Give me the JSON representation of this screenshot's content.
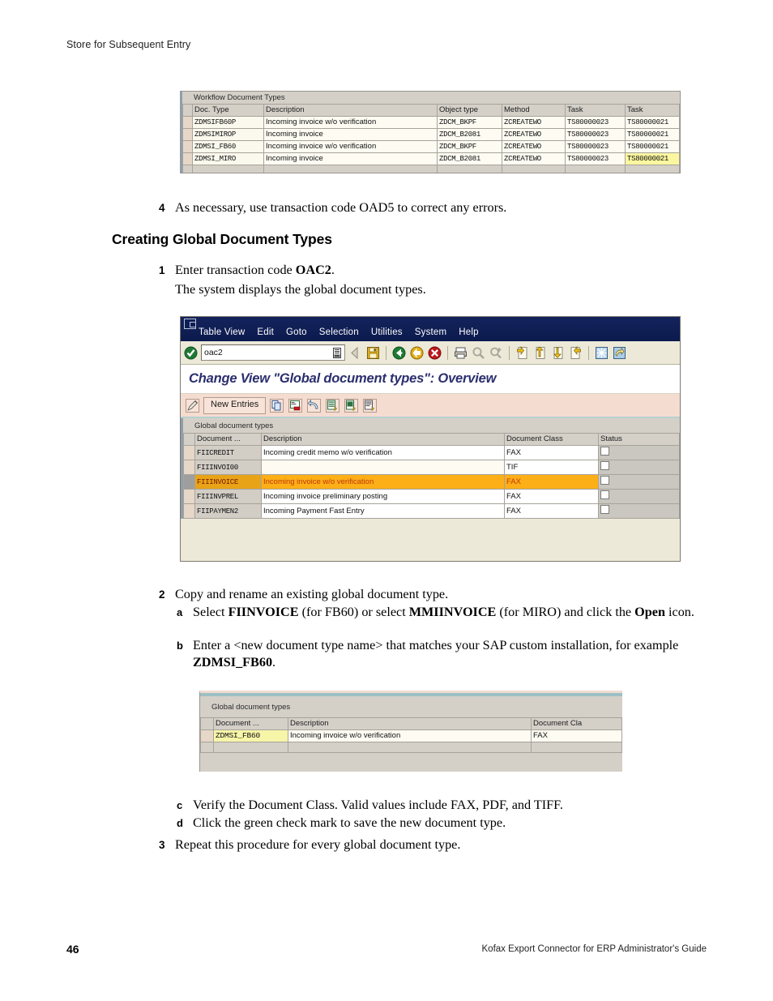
{
  "page": {
    "running_head": "Store for Subsequent Entry",
    "page_number": "46",
    "footer_title": "Kofax Export Connector for ERP Administrator's Guide"
  },
  "figure_workflow": {
    "caption": "Workflow Document Types",
    "columns": [
      "Doc. Type",
      "Description",
      "Object type",
      "Method",
      "Task",
      "Task"
    ],
    "rows": [
      {
        "doc_type": "ZDMSIFB60P",
        "description": "Incoming invoice w/o verification",
        "object_type": "ZDCM_BKPF",
        "method": "ZCREATEWO",
        "task1": "TS80000023",
        "task2": "TS80000021"
      },
      {
        "doc_type": "ZDMSIMIROP",
        "description": "Incoming invoice",
        "object_type": "ZDCM_B2081",
        "method": "ZCREATEWO",
        "task1": "TS80000023",
        "task2": "TS80000021"
      },
      {
        "doc_type": "ZDMSI_FB60",
        "description": "Incoming invoice w/o verification",
        "object_type": "ZDCM_BKPF",
        "method": "ZCREATEWO",
        "task1": "TS80000023",
        "task2": "TS80000021"
      },
      {
        "doc_type": "ZDMSI_MIRO",
        "description": "Incoming invoice",
        "object_type": "ZDCM_B2081",
        "method": "ZCREATEWO",
        "task1": "TS80000023",
        "task2": "TS80000021"
      }
    ]
  },
  "step4": {
    "number": "4",
    "text_before": "As necessary, use transaction code ",
    "code": "OAD5",
    "text_after": " to correct any errors."
  },
  "heading": "Creating Global Document Types",
  "step1": {
    "number": "1",
    "text_before": "Enter transaction code ",
    "code": "OAC2",
    "text_after": ".",
    "result": "The system displays the global document types."
  },
  "figure_oac2": {
    "menu": [
      "Table View",
      "Edit",
      "Goto",
      "Selection",
      "Utilities",
      "System",
      "Help"
    ],
    "command_field_value": "oac2",
    "title": "Change View \"Global document types\": Overview",
    "app_toolbar": {
      "new_entries_label": "New Entries"
    },
    "grid": {
      "caption": "Global document types",
      "columns": [
        "Document ...",
        "Description",
        "Document Class",
        "Status"
      ],
      "rows": [
        {
          "document": "FIICREDIT",
          "description": "Incoming credit memo w/o verification",
          "document_class": "FAX",
          "selected": false
        },
        {
          "document": "FIIINVOI00",
          "description": "",
          "document_class": "TIF",
          "selected": false
        },
        {
          "document": "FIIINVOICE",
          "description": "Incoming invoice w/o verification",
          "document_class": "FAX",
          "selected": true
        },
        {
          "document": "FIIINVPREL",
          "description": "Incoming invoice preliminary posting",
          "document_class": "FAX",
          "selected": false
        },
        {
          "document": "FIIPAYMEN2",
          "description": "Incoming Payment Fast Entry",
          "document_class": "FAX",
          "selected": false
        }
      ]
    }
  },
  "step2": {
    "number": "2",
    "text": "Copy and rename an existing global document type.",
    "substeps": [
      {
        "letter": "a",
        "parts": [
          {
            "t": "Select ",
            "b": false
          },
          {
            "t": "FIINVOICE",
            "b": true
          },
          {
            "t": " (for FB60) or select ",
            "b": false
          },
          {
            "t": "MMIINVOICE",
            "b": true
          },
          {
            "t": " (for MIRO) and click the ",
            "b": false
          },
          {
            "t": "Open",
            "b": true
          },
          {
            "t": " icon.",
            "b": false
          }
        ]
      },
      {
        "letter": "b",
        "parts": [
          {
            "t": "Enter a <new document type name> that matches your SAP custom installation, for example ",
            "b": false
          },
          {
            "t": "ZDMSI_FB60",
            "b": true
          },
          {
            "t": ".",
            "b": false
          }
        ]
      }
    ]
  },
  "figure_copy": {
    "caption": "Global document types",
    "columns": [
      "Document ...",
      "Description",
      "Document Cla"
    ],
    "row": {
      "document": "ZDMSI_FB60",
      "description": "Incoming invoice w/o verification",
      "document_class": "FAX"
    }
  },
  "substeps_cd": [
    {
      "letter": "c",
      "text": "Verify the Document Class. Valid values include FAX, PDF, and TIFF."
    },
    {
      "letter": "d",
      "text": "Click the green check mark to save the new document type."
    }
  ],
  "step3": {
    "number": "3",
    "text": "Repeat this procedure for every global document type."
  },
  "colors": {
    "menubar": "#0e1e55",
    "title_text": "#2b2f6e",
    "app_toolbar": "#f5dcd0",
    "selection_orange": "#fcaf17",
    "highlight_yellow": "#f7f5a8"
  }
}
